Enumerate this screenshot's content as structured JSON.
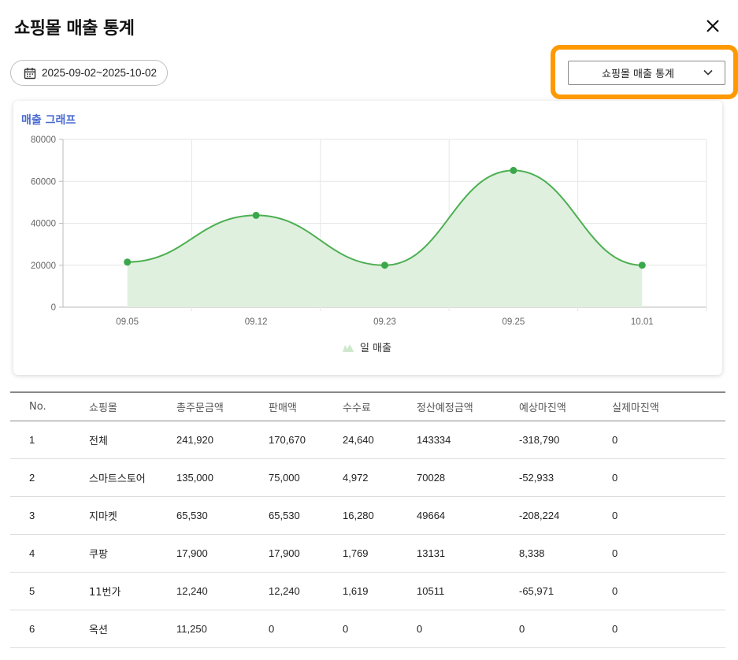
{
  "header": {
    "title": "쇼핑몰 매출 통계"
  },
  "filters": {
    "date_range": "2025-09-02~2025-10-02",
    "select_value": "쇼핑몰 매출 통계"
  },
  "chart_card": {
    "title": "매출 그래프",
    "legend": "일 매출"
  },
  "chart_data": {
    "type": "area",
    "x": [
      "09.05",
      "09.12",
      "09.23",
      "09.25",
      "10.01"
    ],
    "series": [
      {
        "name": "일 매출",
        "values": [
          21500,
          43800,
          20000,
          65200,
          20000
        ]
      }
    ],
    "y_ticks": [
      "0",
      "20000",
      "40000",
      "60000",
      "80000"
    ],
    "ylim": [
      0,
      80000
    ],
    "grid": true,
    "legend_position": "bottom",
    "colors": {
      "line": "#4caf50",
      "fill": "#dff0df",
      "point": "#3aa84a"
    }
  },
  "table": {
    "columns": [
      "No.",
      "쇼핑몰",
      "총주문금액",
      "판매액",
      "수수료",
      "정산예정금액",
      "예상마진액",
      "실제마진액"
    ],
    "rows": [
      [
        "1",
        "전체",
        "241,920",
        "170,670",
        "24,640",
        "143334",
        "-318,790",
        "0"
      ],
      [
        "2",
        "스마트스토어",
        "135,000",
        "75,000",
        "4,972",
        "70028",
        "-52,933",
        "0"
      ],
      [
        "3",
        "지마켓",
        "65,530",
        "65,530",
        "16,280",
        "49664",
        "-208,224",
        "0"
      ],
      [
        "4",
        "쿠팡",
        "17,900",
        "17,900",
        "1,769",
        "13131",
        "8,338",
        "0"
      ],
      [
        "5",
        "11번가",
        "12,240",
        "12,240",
        "1,619",
        "10511",
        "-65,971",
        "0"
      ],
      [
        "6",
        "옥션",
        "11,250",
        "0",
        "0",
        "0",
        "0",
        "0"
      ]
    ]
  },
  "icons": {
    "close": "close-icon",
    "calendar": "calendar-icon",
    "dropdown": "chevron-down-icon"
  },
  "accent_colors": {
    "highlight": "#ff9900",
    "chart_title": "#4a6bd1"
  }
}
